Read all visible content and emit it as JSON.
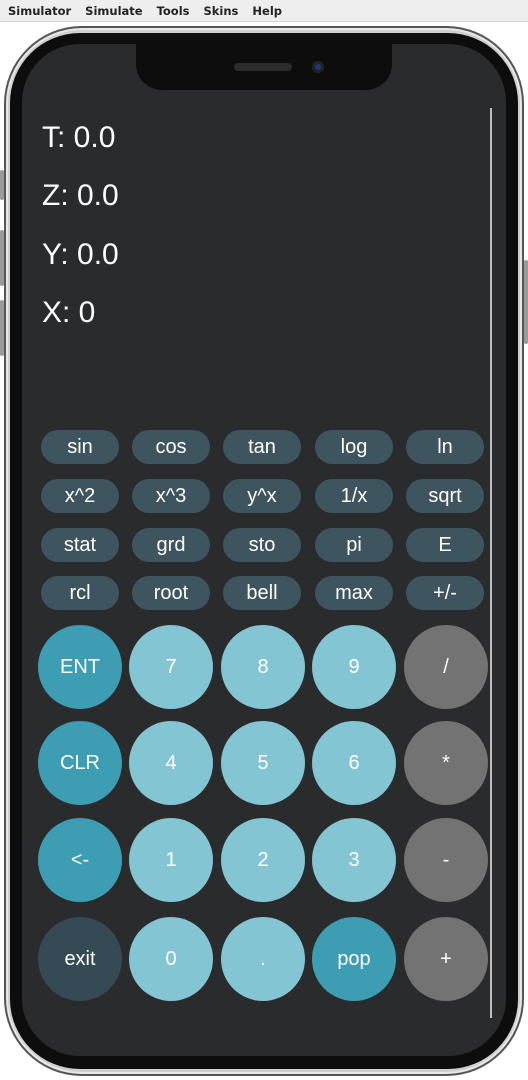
{
  "menubar": {
    "items": [
      "Simulator",
      "Simulate",
      "Tools",
      "Skins",
      "Help"
    ]
  },
  "stack": {
    "t": "T: 0.0",
    "z": "Z: 0.0",
    "y": "Y: 0.0",
    "x": "X: 0"
  },
  "function_keys": [
    [
      "sin",
      "cos",
      "tan",
      "log",
      "ln"
    ],
    [
      "x^2",
      "x^3",
      "y^x",
      "1/x",
      "sqrt"
    ],
    [
      "stat",
      "grd",
      "sto",
      "pi",
      "E"
    ],
    [
      "rcl",
      "root",
      "bell",
      "max",
      "+/-"
    ]
  ],
  "keypad": [
    [
      "ENT",
      "7",
      "8",
      "9",
      "/"
    ],
    [
      "CLR",
      "4",
      "5",
      "6",
      "*"
    ],
    [
      "<-",
      "1",
      "2",
      "3",
      "-"
    ],
    [
      "exit",
      "0",
      ".",
      "pop",
      "+"
    ]
  ],
  "colors": {
    "screen_bg": "#2a2b2c",
    "function_key": "#3e5560",
    "operation_key": "#3d9db3",
    "digit_key": "#84c5d3",
    "arithmetic_key": "#737373",
    "exit_key": "#354a55",
    "text": "#ffffff"
  }
}
